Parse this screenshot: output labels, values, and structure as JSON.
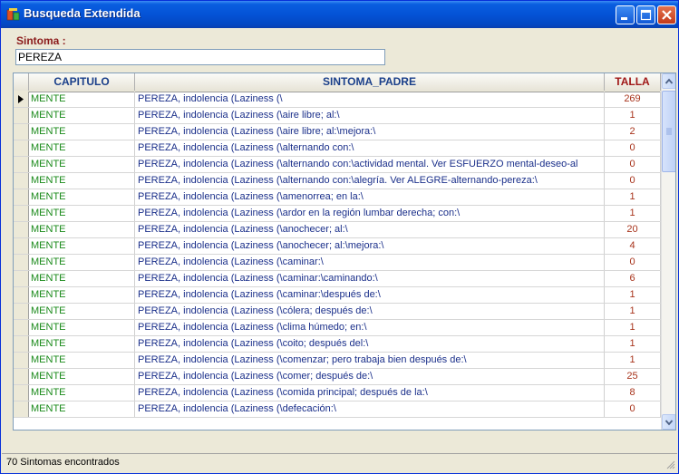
{
  "window": {
    "title": "Busqueda Extendida",
    "accent": "#0453d6"
  },
  "titlebar_buttons": [
    "minimize-icon",
    "maximize-icon",
    "close-icon"
  ],
  "search": {
    "label": "Sintoma :",
    "value": "PEREZA"
  },
  "table": {
    "columns": [
      "CAPITULO",
      "SINTOMA_PADRE",
      "TALLA"
    ],
    "rows": [
      {
        "capitulo": "MENTE",
        "sintoma_padre": "PEREZA, indolencia (Laziness (\\",
        "talla": "269"
      },
      {
        "capitulo": "MENTE",
        "sintoma_padre": "PEREZA, indolencia (Laziness (\\aire libre; al:\\",
        "talla": "1"
      },
      {
        "capitulo": "MENTE",
        "sintoma_padre": "PEREZA, indolencia (Laziness (\\aire libre; al:\\mejora:\\",
        "talla": "2"
      },
      {
        "capitulo": "MENTE",
        "sintoma_padre": "PEREZA, indolencia (Laziness (\\alternando con:\\",
        "talla": "0"
      },
      {
        "capitulo": "MENTE",
        "sintoma_padre": "PEREZA, indolencia (Laziness (\\alternando con:\\actividad mental. Ver ESFUERZO mental-deseo-al",
        "talla": "0"
      },
      {
        "capitulo": "MENTE",
        "sintoma_padre": "PEREZA, indolencia (Laziness (\\alternando con:\\alegría. Ver ALEGRE-alternando-pereza:\\",
        "talla": "0"
      },
      {
        "capitulo": "MENTE",
        "sintoma_padre": "PEREZA, indolencia (Laziness (\\amenorrea; en la:\\",
        "talla": "1"
      },
      {
        "capitulo": "MENTE",
        "sintoma_padre": "PEREZA, indolencia (Laziness (\\ardor en la región lumbar derecha; con:\\",
        "talla": "1"
      },
      {
        "capitulo": "MENTE",
        "sintoma_padre": "PEREZA, indolencia (Laziness (\\anochecer; al:\\",
        "talla": "20"
      },
      {
        "capitulo": "MENTE",
        "sintoma_padre": "PEREZA, indolencia (Laziness (\\anochecer; al:\\mejora:\\",
        "talla": "4"
      },
      {
        "capitulo": "MENTE",
        "sintoma_padre": "PEREZA, indolencia (Laziness (\\caminar:\\",
        "talla": "0"
      },
      {
        "capitulo": "MENTE",
        "sintoma_padre": "PEREZA, indolencia (Laziness (\\caminar:\\caminando:\\",
        "talla": "6"
      },
      {
        "capitulo": "MENTE",
        "sintoma_padre": "PEREZA, indolencia (Laziness (\\caminar:\\después de:\\",
        "talla": "1"
      },
      {
        "capitulo": "MENTE",
        "sintoma_padre": "PEREZA, indolencia (Laziness (\\cólera; después de:\\",
        "talla": "1"
      },
      {
        "capitulo": "MENTE",
        "sintoma_padre": "PEREZA, indolencia (Laziness (\\clima húmedo; en:\\",
        "talla": "1"
      },
      {
        "capitulo": "MENTE",
        "sintoma_padre": "PEREZA, indolencia (Laziness (\\coito; después del:\\",
        "talla": "1"
      },
      {
        "capitulo": "MENTE",
        "sintoma_padre": "PEREZA, indolencia (Laziness (\\comenzar; pero trabaja bien después de:\\",
        "talla": "1"
      },
      {
        "capitulo": "MENTE",
        "sintoma_padre": "PEREZA, indolencia (Laziness (\\comer; después de:\\",
        "talla": "25"
      },
      {
        "capitulo": "MENTE",
        "sintoma_padre": "PEREZA, indolencia (Laziness (\\comida principal; después de la:\\",
        "talla": "8"
      },
      {
        "capitulo": "MENTE",
        "sintoma_padre": "PEREZA, indolencia (Laziness (\\defecación:\\",
        "talla": "0"
      }
    ]
  },
  "status": {
    "text": "70 Sintomas encontrados"
  }
}
